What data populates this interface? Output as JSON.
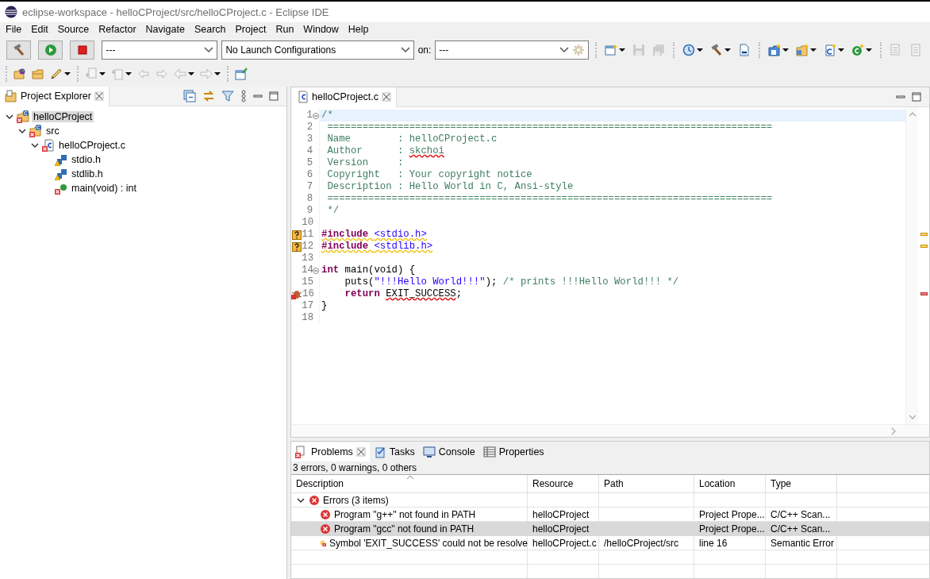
{
  "window": {
    "title": "eclipse-workspace - helloCProject/src/helloCProject.c - Eclipse IDE"
  },
  "menu": [
    "File",
    "Edit",
    "Source",
    "Refactor",
    "Navigate",
    "Search",
    "Project",
    "Run",
    "Window",
    "Help"
  ],
  "toolbar": {
    "build_config": "---",
    "launch_config": "No Launch Configurations",
    "target_label": "on:",
    "target": "---",
    "tools": [
      {
        "kind": "new-window",
        "disabled": false,
        "dropdown": true
      },
      {
        "kind": "save",
        "disabled": true,
        "dropdown": false
      },
      {
        "kind": "save-all",
        "disabled": true,
        "dropdown": false
      },
      {
        "kind": "separator"
      },
      {
        "kind": "debug",
        "disabled": false,
        "dropdown": true
      },
      {
        "kind": "hammer",
        "disabled": false,
        "dropdown": true
      },
      {
        "kind": "binary",
        "disabled": false,
        "dropdown": false
      },
      {
        "kind": "separator"
      },
      {
        "kind": "new-project",
        "disabled": false,
        "dropdown": true
      },
      {
        "kind": "new-folder",
        "disabled": false,
        "dropdown": true
      },
      {
        "kind": "new-file",
        "disabled": false,
        "dropdown": true
      },
      {
        "kind": "new-class",
        "disabled": false,
        "dropdown": true
      },
      {
        "kind": "separator"
      },
      {
        "kind": "toggle",
        "disabled": true,
        "dropdown": false
      },
      {
        "kind": "page",
        "disabled": true,
        "dropdown": false
      }
    ]
  },
  "toolbar2": [
    {
      "kind": "open-project",
      "disabled": false,
      "dropdown": false
    },
    {
      "kind": "open-folder",
      "disabled": false,
      "dropdown": false
    },
    {
      "kind": "pen",
      "disabled": false,
      "dropdown": true
    },
    {
      "kind": "separator"
    },
    {
      "kind": "next-annotation",
      "disabled": true,
      "dropdown": true
    },
    {
      "kind": "prev-annotation",
      "disabled": true,
      "dropdown": true
    },
    {
      "kind": "last-edit",
      "disabled": true,
      "dropdown": false
    },
    {
      "kind": "next-edit",
      "disabled": true,
      "dropdown": false
    },
    {
      "kind": "back",
      "disabled": true,
      "dropdown": true
    },
    {
      "kind": "forward",
      "disabled": true,
      "dropdown": true
    },
    {
      "kind": "separator"
    },
    {
      "kind": "pin",
      "disabled": false,
      "dropdown": false
    }
  ],
  "explorer": {
    "title": "Project Explorer",
    "tree": [
      {
        "label": "helloCProject",
        "kind": "project",
        "error_badge": true,
        "expanded": true,
        "selected": true,
        "children": [
          {
            "label": "src",
            "kind": "folder",
            "error_badge": true,
            "expanded": true,
            "selected": false,
            "children": [
              {
                "label": "helloCProject.c",
                "kind": "c-file",
                "error_badge": true,
                "expanded": true,
                "selected": false,
                "children": [
                  {
                    "label": "stdio.h",
                    "kind": "include",
                    "warning_badge": true,
                    "selected": false
                  },
                  {
                    "label": "stdlib.h",
                    "kind": "include",
                    "warning_badge": true,
                    "selected": false
                  },
                  {
                    "label": "main(void) : int",
                    "kind": "function",
                    "error_badge": true,
                    "selected": false
                  }
                ]
              }
            ]
          }
        ]
      }
    ]
  },
  "editor": {
    "tab": {
      "label": "helloCProject.c",
      "selected": true
    },
    "lines": [
      {
        "number": "1",
        "fold": true,
        "current": true,
        "tokens": [
          {
            "text": "/*",
            "kind": "comment"
          }
        ]
      },
      {
        "number": "2",
        "tokens": [
          {
            "text": " ============================================================================",
            "kind": "comment"
          }
        ]
      },
      {
        "number": "3",
        "tokens": [
          {
            "text": " Name        : helloCProject.c",
            "kind": "comment"
          }
        ]
      },
      {
        "number": "4",
        "tokens": [
          {
            "text": " Author      : ",
            "kind": "comment"
          },
          {
            "text": "skchoi",
            "kind": "comment",
            "error_squiggle": true
          }
        ]
      },
      {
        "number": "5",
        "tokens": [
          {
            "text": " Version     :",
            "kind": "comment"
          }
        ]
      },
      {
        "number": "6",
        "tokens": [
          {
            "text": " Copyright   : Your copyright notice",
            "kind": "comment"
          }
        ]
      },
      {
        "number": "7",
        "tokens": [
          {
            "text": " Description : Hello World in C, Ansi-style",
            "kind": "comment"
          }
        ]
      },
      {
        "number": "8",
        "tokens": [
          {
            "text": " ============================================================================",
            "kind": "comment"
          }
        ]
      },
      {
        "number": "9",
        "tokens": [
          {
            "text": " */",
            "kind": "comment"
          }
        ]
      },
      {
        "number": "10"
      },
      {
        "number": "11",
        "warning_marker": true,
        "tokens": [
          {
            "text": "#include ",
            "kind": "keyword",
            "warning_squiggle": true
          },
          {
            "text": "<stdio.h>",
            "kind": "string",
            "warning_squiggle": true
          }
        ]
      },
      {
        "number": "12",
        "warning_marker": true,
        "tokens": [
          {
            "text": "#include ",
            "kind": "keyword",
            "warning_squiggle": true
          },
          {
            "text": "<stdlib.h>",
            "kind": "string",
            "warning_squiggle": true
          }
        ]
      },
      {
        "number": "13"
      },
      {
        "number": "14",
        "fold": true,
        "tokens": [
          {
            "text": "int",
            "kind": "keyword"
          },
          {
            "text": " main(void) {",
            "kind": "plain"
          }
        ]
      },
      {
        "number": "15",
        "tokens": [
          {
            "text": "    puts(",
            "kind": "plain"
          },
          {
            "text": "\"!!!Hello World!!!\"",
            "kind": "string"
          },
          {
            "text": "); ",
            "kind": "plain"
          },
          {
            "text": "/* prints !!!Hello World!!! */",
            "kind": "comment"
          }
        ]
      },
      {
        "number": "16",
        "error_marker": true,
        "tokens": [
          {
            "text": "    return ",
            "kind": "keyword"
          },
          {
            "text": "EXIT_SUCCESS",
            "kind": "plain",
            "error_squiggle": true
          },
          {
            "text": ";",
            "kind": "plain"
          }
        ]
      },
      {
        "number": "17",
        "tokens": [
          {
            "text": "}",
            "kind": "plain"
          }
        ]
      },
      {
        "number": "18"
      }
    ]
  },
  "bottom_tabs": [
    {
      "label": "Problems",
      "kind": "problems",
      "selected": true
    },
    {
      "label": "Tasks",
      "kind": "tasks",
      "selected": false
    },
    {
      "label": "Console",
      "kind": "console",
      "selected": false
    },
    {
      "label": "Properties",
      "kind": "properties",
      "selected": false
    }
  ],
  "problems": {
    "summary": "3 errors, 0 warnings, 0 others",
    "columns": [
      "Description",
      "Resource",
      "Path",
      "Location",
      "Type"
    ],
    "groups": [
      {
        "label": "Errors (3 items)",
        "expanded": true,
        "items": [
          {
            "kind": "error",
            "selected": false,
            "cells": [
              "Program \"g++\" not found in PATH",
              "helloCProject",
              null,
              "Project Prope...",
              "C/C++ Scan..."
            ]
          },
          {
            "kind": "error",
            "selected": true,
            "cells": [
              "Program \"gcc\" not found in PATH",
              "helloCProject",
              null,
              "Project Prope...",
              "C/C++ Scan..."
            ]
          },
          {
            "kind": "semantic",
            "selected": false,
            "cells": [
              "Symbol 'EXIT_SUCCESS' could not be resolve",
              "helloCProject.c",
              "/helloCProject/src",
              "line 16",
              "Semantic Error"
            ]
          }
        ]
      }
    ]
  }
}
